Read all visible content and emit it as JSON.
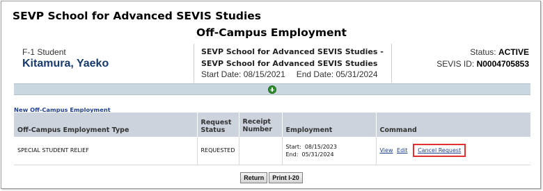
{
  "header": {
    "school_name": "SEVP School for Advanced SEVIS Studies",
    "page_title": "Off-Campus Employment"
  },
  "student": {
    "type": "F-1 Student",
    "name": "Kitamura, Yaeko"
  },
  "school_info": {
    "line1": "SEVP School for Advanced SEVIS Studies -",
    "line2": "SEVP School for Advanced SEVIS Studies",
    "start_date": "Start Date: 08/15/2021",
    "end_date": "End Date: 05/31/2024"
  },
  "status": {
    "label": "Status:",
    "value": "ACTIVE",
    "sevis_label": "SEVIS ID:",
    "sevis_id": "N0004705853"
  },
  "add_bar": {
    "icon": "plus-circle-icon",
    "color": "#2e8b2e"
  },
  "new_link": "New Off-Campus Employment",
  "table": {
    "headers": {
      "type": "Off-Campus Employment Type",
      "request_status": "Request Status",
      "receipt_number": "Receipt Number",
      "employment": "Employment",
      "command": "Command"
    },
    "rows": [
      {
        "type": "SPECIAL STUDENT RELIEF",
        "request_status": "REQUESTED",
        "receipt_number": "",
        "employment": "Start:  08/15/2023\nEnd:  05/31/2024",
        "view": "View",
        "edit": "Edit",
        "cancel": "Cancel Request"
      }
    ]
  },
  "buttons": {
    "return": "Return",
    "print": "Print I-20"
  },
  "colors": {
    "highlight": "#e03030",
    "link": "#1f3f8f",
    "header_bg": "#ccd3dc",
    "name": "#163a6e"
  }
}
